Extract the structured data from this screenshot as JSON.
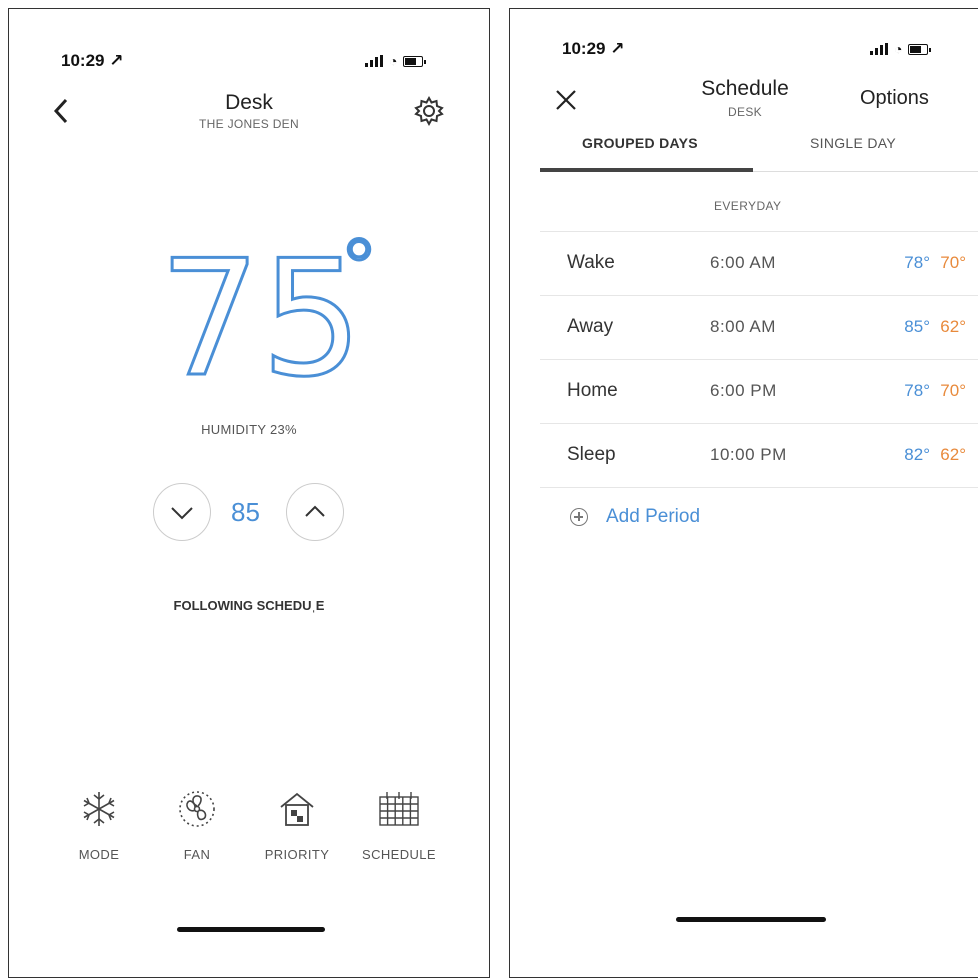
{
  "left_screen": {
    "status_time": "10:29 ↗",
    "title": "Desk",
    "subtitle": "THE JONES DEN",
    "temperature": "75",
    "degree_symbol": "°",
    "humidity": "HUMIDITY 23%",
    "setpoint": "85",
    "status": "FOLLOWING SCHEDUˌE",
    "nav": {
      "mode": "MODE",
      "fan": "FAN",
      "priority": "PRIORITY",
      "schedule": "SCHEDULE"
    },
    "icons": {
      "back": "back-chevron-icon",
      "settings": "gear-icon",
      "decrease": "chevron-down-icon",
      "increase": "chevron-up-icon"
    }
  },
  "right_screen": {
    "status_time": "10:29 ↗",
    "title": "Schedule",
    "subtitle": "DESK",
    "options": "Options",
    "tabs": [
      "GROUPED DAYS",
      "SINGLE DAY"
    ],
    "day_group": "EVERYDAY",
    "periods": [
      {
        "name": "Wake",
        "time": "6:00 AM",
        "cool": "78°",
        "heat": "70°"
      },
      {
        "name": "Away",
        "time": "8:00 AM",
        "cool": "85°",
        "heat": "62°"
      },
      {
        "name": "Home",
        "time": "6:00 PM",
        "cool": "78°",
        "heat": "70°"
      },
      {
        "name": "Sleep",
        "time": "10:00 PM",
        "cool": "82°",
        "heat": "62°"
      }
    ],
    "add_period": "Add Period"
  },
  "colors": {
    "accent_blue": "#4a8fd6",
    "heat_orange": "#e88a3c",
    "text_dark": "#222222"
  }
}
